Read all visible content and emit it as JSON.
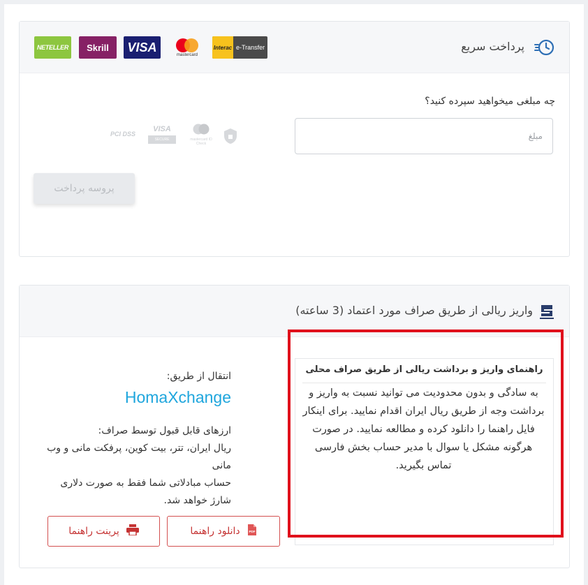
{
  "quick_pay": {
    "title": "پرداخت سریع",
    "logos": {
      "neteller": "NETELLER",
      "skrill": "Skrill",
      "visa": "VISA",
      "mastercard": "mastercard",
      "interac": "Interac",
      "etransfer": "e-Transfer"
    },
    "question": "چه مبلغی میخواهید سپرده کنید؟",
    "amount_placeholder": "مبلغ",
    "proceed_label": "پروسه پرداخت",
    "security": {
      "pci": "PCI DSS",
      "visa_secure": "VISA",
      "visa_secure_sub": "SECURE",
      "mc_check": "mastercard ID Check"
    }
  },
  "rial_deposit": {
    "title": "واریز ریالی از طریق صراف مورد اعتماد (3 ساعته)",
    "guide_title": "راهنمای واریز و برداشت ریالی از طریق صراف محلی",
    "guide_text": "به سادگی و بدون محدودیت می توانید نسبت به واریز و برداشت وجه از طریق ریال ایران اقدام نمایید. برای اینکار فایل راهنما را دانلود کرده و مطالعه نمایید. در صورت هرگونه مشکل یا سوال با مدیر حساب بخش فارسی تماس بگیرید.",
    "transfer_via": "انتقال از طریق:",
    "provider": "HomaXchange",
    "accepted_title": "ارزهای قابل قبول توسط صراف:",
    "accepted_list": "ریال ایران، تتر، بیت کوین، پرفکت مانی و وب مانی",
    "note": "حساب مبادلاتی شما فقط به صورت دلاری شارژ خواهد شد.",
    "download_label": "دانلود راهنما",
    "print_label": "پرینت راهنما"
  },
  "colors": {
    "highlight": "#e0101c",
    "provider": "#1fa6dd",
    "button_text": "#c53333",
    "neteller": "#8dc63f",
    "skrill": "#862165",
    "visa": "#1a1f71"
  },
  "icons": [
    "clock-speed-icon",
    "exchange-logo-icon",
    "pdf-icon",
    "printer-icon"
  ]
}
